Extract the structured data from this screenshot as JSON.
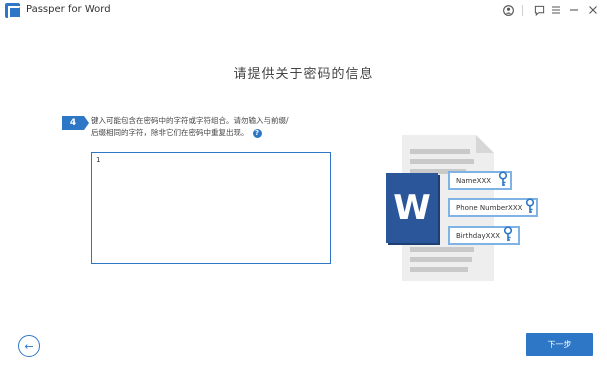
{
  "window": {
    "title": "Passper for Word",
    "controls": [
      "user-icon",
      "feedback-icon",
      "menu-icon",
      "minimize-icon",
      "close-icon"
    ]
  },
  "page": {
    "heading": "请提供关于密码的信息"
  },
  "step": {
    "number": "4",
    "instruction": "键入可能包含在密码中的字符或字符组合。请勿输入与前缀/后缀相同的字符，除非它们在密码中重复出现。",
    "help": "?"
  },
  "input": {
    "value": "1"
  },
  "illustration": {
    "app_letter": "W",
    "fields": [
      "NameXXX",
      "Phone NumberXXX",
      "BirthdayXXX"
    ]
  },
  "nav": {
    "back": "←",
    "next": "下一步"
  },
  "colors": {
    "accent": "#2e77c7",
    "word_blue": "#2b579a",
    "pill_border": "#7fb3e6"
  }
}
